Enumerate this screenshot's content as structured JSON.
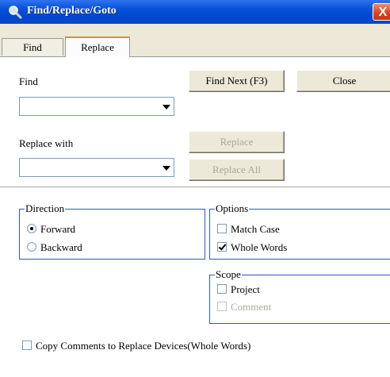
{
  "window": {
    "title": "Find/Replace/Goto",
    "close_label": "X"
  },
  "tabs": [
    {
      "label": "Find"
    },
    {
      "label": "Replace"
    }
  ],
  "find": {
    "label": "Find",
    "value": ""
  },
  "replace": {
    "label": "Replace with",
    "value": ""
  },
  "buttons": {
    "find_next": "Find Next (F3)",
    "close": "Close",
    "replace": "Replace",
    "replace_all": "Replace All"
  },
  "direction": {
    "label": "Direction",
    "forward": "Forward",
    "backward": "Backward",
    "selected": "Forward"
  },
  "options": {
    "label": "Options",
    "match_case": "Match Case",
    "whole_words": "Whole Words",
    "match_case_checked": false,
    "whole_words_checked": true
  },
  "scope": {
    "label": "Scope",
    "project": "Project",
    "comment": "Comment",
    "project_checked": false,
    "comment_enabled": false
  },
  "copy_comments": {
    "label": "Copy Comments to Replace Devices(Whole Words)",
    "checked": false
  },
  "colors": {
    "title_bar": "#0a53d9",
    "group_border": "#2b59c6",
    "tab_accent": "#e68b2c",
    "close_button": "#d8401e"
  }
}
